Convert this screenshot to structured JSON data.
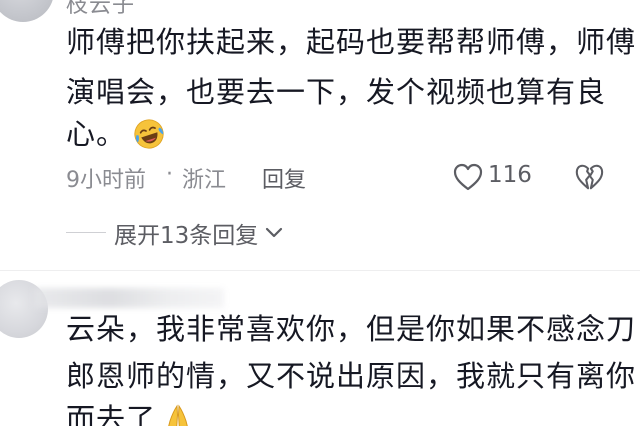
{
  "comment1": {
    "username_partial": "枝云子",
    "lines": [
      "师傅把你扶起来，起码也要帮帮师傅，师傅",
      "演唱会，也要去一下，发个视频也算有良",
      "心。"
    ],
    "emoji": "laughing-crying-emoji",
    "time": "9小时前",
    "dot": "·",
    "location": "浙江",
    "reply_label": "回复",
    "like_count": "116",
    "expand_label": "展开13条回复"
  },
  "comment2": {
    "lines": [
      "云朵，我非常喜欢你，但是你如果不感念刀",
      "郎恩师的情，又不说出原因，我就只有离你",
      "而去了"
    ],
    "emoji": "praying-hands-emoji"
  },
  "colors": {
    "text_primary": "#161823",
    "text_secondary": "#8a8b91",
    "emoji_yellow": "#f6c33b",
    "emoji_tear": "#4aa3ea"
  }
}
